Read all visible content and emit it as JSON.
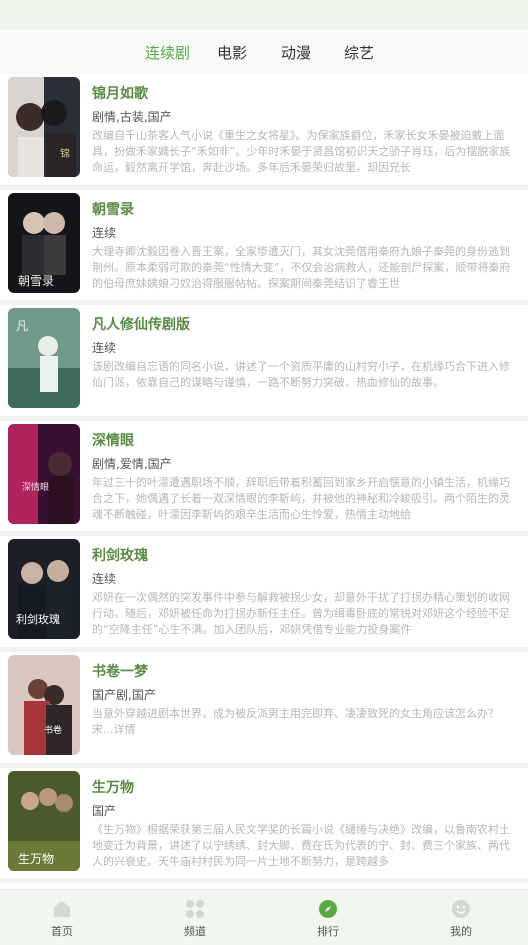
{
  "tabs": [
    {
      "label": "连续剧",
      "active": true
    },
    {
      "label": "电影",
      "active": false
    },
    {
      "label": "动漫",
      "active": false
    },
    {
      "label": "综艺",
      "active": false
    }
  ],
  "items": [
    {
      "title": "锦月如歌",
      "genre": "剧情,古装,国产",
      "desc": "改编自千山茶客人气小说《重生之女将星》。为保家族爵位，禾家长女禾晏被迫戴上面具，扮做禾家嫡长子“禾如非”。少年时禾晏于贤昌馆初识天之骄子肖珏，后为摆脱家族命运，毅然离开学馆，奔赴沙场。多年后禾晏荣归故里，却因兄长"
    },
    {
      "title": "朝雪录",
      "genre": "连续",
      "desc": "大理寺卿沈毅因卷入晋王案，全家惨遭灭门，其女沈莞借用秦府九娘子秦莞的身份逃到荆州。原本柔弱可欺的秦莞“性情大变”，不仅会治病救人，还能剖尸探案，顺带将秦府的伯母庶妹姨娘刁奴治得服服帖帖。探案期间秦莞结识了睿王世"
    },
    {
      "title": "凡人修仙传剧版",
      "genre": "连续",
      "desc": "该剧改编自忘语的同名小说，讲述了一个资质平庸的山村穷小子，在机缘巧合下进入修仙门派，依靠自己的谋略与谨慎，一路不断努力突破、热血修仙的故事。"
    },
    {
      "title": "深情眼",
      "genre": "剧情,爱情,国产",
      "desc": "年过三十的叶濛遭遇职场不顺，辞职后带着积蓄回到家乡开启惬意的小镇生活，机缘巧合之下，她偶遇了长着一双深情眼的李靳屿，并被他的神秘和冷峻吸引。两个陌生的灵魂不断触碰，叶濛因李靳屿的艰辛生活而心生怜爱，热情主动地给"
    },
    {
      "title": "利剑玫瑰",
      "genre": "连续",
      "desc": "邓妍在一次偶然的突发事件中参与解救被拐少女，却意外干扰了打拐办精心策划的收网行动。随后，邓妍被任命为打拐办新任主任。曾为缉毒卧底的常锐对邓妍这个经验不足的“空降主任”心生不满。加入团队后，邓妍凭借专业能力投身案件"
    },
    {
      "title": "书卷一梦",
      "genre": "国产剧,国产",
      "desc": "当意外穿越进剧本世界，成为被反派男主用完即弃、凄凄致死的女主角应该怎么办？宋...详情"
    },
    {
      "title": "生万物",
      "genre": "国产",
      "desc": "《生万物》根据荣获第三届人民文学奖的长篇小说《缱绻与决绝》改编，以鲁南农村土地变迁为背景，讲述了以宁绣绣、封大脚、费在氏为代表的宁、封、费三个家族、两代人的兴衰史。天牛庙村村民为同一片土地不断努力，是跨越多"
    }
  ],
  "bottom_nav": [
    {
      "label": "首页",
      "icon": "home-icon"
    },
    {
      "label": "频道",
      "icon": "grid-icon"
    },
    {
      "label": "排行",
      "icon": "compass-icon",
      "active": true
    },
    {
      "label": "我的",
      "icon": "smile-icon"
    }
  ],
  "colors": {
    "accent": "#5aa845",
    "title": "#5a8a43",
    "nav_bg": "#f1f7ef"
  }
}
